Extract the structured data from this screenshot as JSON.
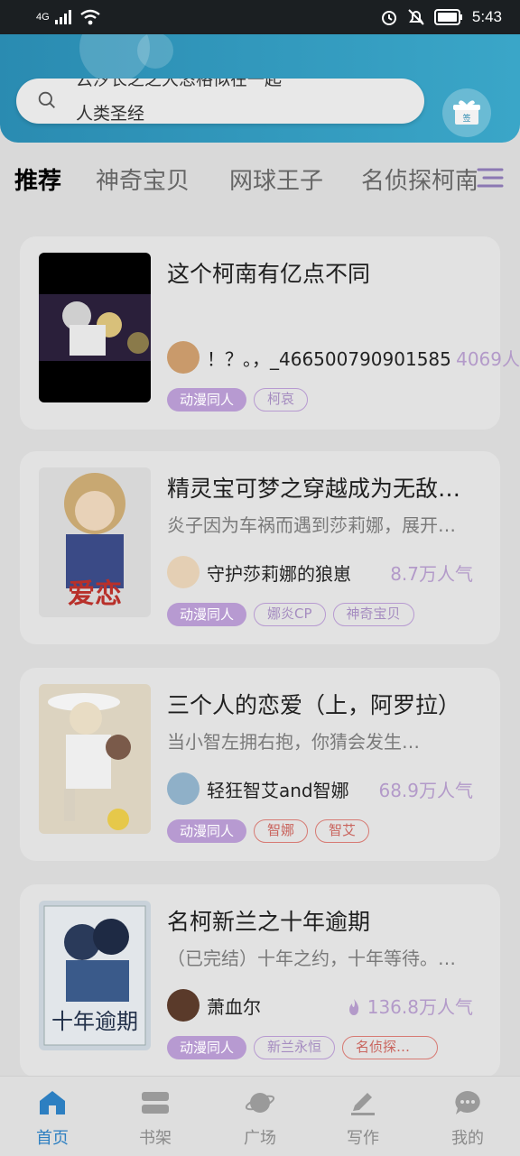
{
  "status_bar": {
    "network": "4G",
    "time": "5:43"
  },
  "search": {
    "line1": "云汐长之之大恣格似在一起",
    "line2": "人类圣经",
    "gift_label": "签"
  },
  "tabs": [
    {
      "label": "推荐",
      "active": true
    },
    {
      "label": "神奇宝贝",
      "active": false
    },
    {
      "label": "网球王子",
      "active": false
    },
    {
      "label": "名侦探柯南",
      "active": false
    }
  ],
  "cards": [
    {
      "title": "这个柯南有亿点不同",
      "description": "",
      "author": "！？。，_466500790901585",
      "popularity": "4069人",
      "tags": [
        "动漫同人",
        "柯哀"
      ]
    },
    {
      "title": "精灵宝可梦之穿越成为无敌…",
      "description": "炎子因为车祸而遇到莎莉娜，展开…",
      "author": "守护莎莉娜的狼崽",
      "popularity": "8.7万人气",
      "tags": [
        "动漫同人",
        "娜炎CP",
        "神奇宝贝"
      ]
    },
    {
      "title": "三个人的恋爱（上，阿罗拉）",
      "description": "当小智左拥右抱，你猜会发生…",
      "author": "轻狂智艾and智娜",
      "popularity": "68.9万人气",
      "tags": [
        "动漫同人",
        "智娜",
        "智艾"
      ]
    },
    {
      "title": "名柯新兰之十年逾期",
      "description": "（已完结）十年之约，十年等待。…",
      "author": "萧血尔",
      "popularity": "136.8万人气",
      "tags": [
        "动漫同人",
        "新兰永恒",
        "名侦探…"
      ]
    }
  ],
  "bottom_nav": [
    {
      "label": "首页",
      "icon": "home-icon",
      "active": true
    },
    {
      "label": "书架",
      "icon": "bookshelf-icon",
      "active": false
    },
    {
      "label": "广场",
      "icon": "planet-icon",
      "active": false
    },
    {
      "label": "写作",
      "icon": "pen-icon",
      "active": false
    },
    {
      "label": "我的",
      "icon": "profile-icon",
      "active": false
    }
  ],
  "colors": {
    "accent": "#2d7fc1",
    "header": "#2a8bb1",
    "tag": "#b79ad1",
    "tag_red": "#d77a73"
  }
}
